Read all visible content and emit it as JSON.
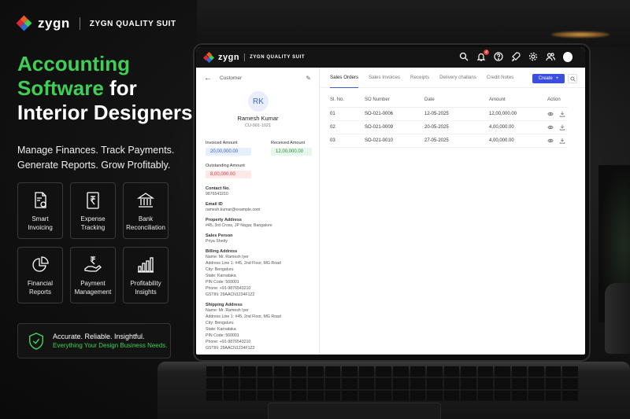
{
  "brand": {
    "name": "zygn",
    "suite": "ZYGN QUALITY SUIT",
    "colors": {
      "orange": "#f15a24",
      "red": "#e0243a",
      "green": "#3fcf56",
      "blue": "#2f6bd8"
    }
  },
  "hero": {
    "line1_green": "Accounting",
    "line2_green": "Software",
    "line2_white": " for",
    "line3": "Interior Designers",
    "tagline1": "Manage Finances. Track Payments.",
    "tagline2": "Generate Reports. Grow Profitably."
  },
  "features": [
    {
      "icon": "invoice-icon",
      "line1": "Smart",
      "line2": "Invoicing"
    },
    {
      "icon": "rupee-receipt-icon",
      "line1": "Expense",
      "line2": "Tracking"
    },
    {
      "icon": "bank-icon",
      "line1": "Bank",
      "line2": "Reconciliation"
    },
    {
      "icon": "pie-chart-icon",
      "line1": "Financial",
      "line2": "Reports"
    },
    {
      "icon": "rupee-hand-icon",
      "line1": "Payment",
      "line2": "Management"
    },
    {
      "icon": "bar-chart-icon",
      "line1": "Profitability",
      "line2": "Insights"
    }
  ],
  "promise": {
    "main": "Accurate. Reliable. Insightful.",
    "sub": "Everything Your Design Business Needs."
  },
  "app": {
    "notification_count": "4",
    "customer": {
      "header": "Customer",
      "initials": "RK",
      "name": "Ramesh Kumar",
      "code": "CU-001-1021",
      "invoiced_label": "Invoiced Amount",
      "invoiced_value": "20,00,000.00",
      "received_label": "Received Amount",
      "received_value": "12,00,000.00",
      "outstanding_label": "Outstanding Amount",
      "outstanding_value": "8,00,000.00",
      "details": [
        {
          "label": "Contact No.",
          "lines": [
            "9876543210"
          ]
        },
        {
          "label": "Email ID",
          "lines": [
            "ramesh.kumar@example.com"
          ]
        },
        {
          "label": "Property Address",
          "lines": [
            "#45, 3rd Cross, JP Nagar, Bangalore"
          ]
        },
        {
          "label": "Sales Person",
          "lines": [
            "Priya Shetty"
          ]
        },
        {
          "label": "Billing Address",
          "lines": [
            "Name: Mr. Ramesh Iyer",
            "Address Line 1: #45, 2nd Floor, MG Road",
            "City: Bengaluru",
            "State: Karnataka",
            "PIN Code: 560001",
            "Phone: +91-9876543210",
            "GSTIN: 29AACN1234F1Z2"
          ]
        },
        {
          "label": "Shipping Address",
          "lines": [
            "Name: Mr. Ramesh Iyer",
            "Address Line 1: #45, 2nd Floor, MG Road",
            "City: Bengaluru",
            "State: Karnataka",
            "PIN Code: 560001",
            "Phone: +91-9876543210",
            "GSTIN: 29AACN1234F1Z2"
          ]
        }
      ]
    },
    "tabs": [
      "Sales Orders",
      "Sales Invoices",
      "Receipts",
      "Delivery challans",
      "Credit Notes"
    ],
    "active_tab": "Sales Orders",
    "create_label": "Create",
    "table": {
      "headers": [
        "Sl. No.",
        "SO Number",
        "Date",
        "Amount",
        "Action"
      ],
      "rows": [
        [
          "01",
          "SO-021-0006",
          "12-05-2025",
          "12,00,000.00"
        ],
        [
          "02",
          "SO-021-0009",
          "20-05-2025",
          "4,00,000.00"
        ],
        [
          "03",
          "SO-021-0010",
          "27-05-2025",
          "4,00,000.00"
        ]
      ]
    }
  }
}
